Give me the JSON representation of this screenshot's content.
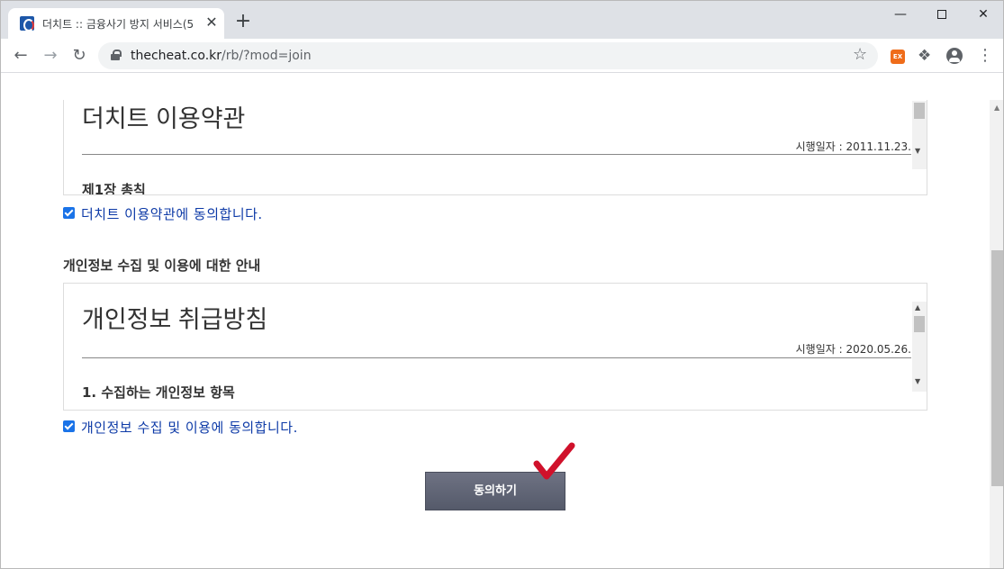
{
  "browser": {
    "tab_title": "더치트 :: 금융사기 방지 서비스(5",
    "tab_close": "✕",
    "new_tab": "+",
    "url_host": "thecheat.co.kr",
    "url_path": "/rb/?mod=join",
    "ext_badge": "EX",
    "icons": [
      "back-icon",
      "forward-icon",
      "reload-icon",
      "lock-icon",
      "star-icon",
      "extension-icon",
      "puzzle-icon",
      "profile-icon",
      "menu-icon"
    ]
  },
  "page": {
    "terms": {
      "title": "더치트 이용약관",
      "effective_date": "시행일자 : 2011.11.23.",
      "first_heading": "제1장 총칙",
      "agree_label": "더치트 이용약관에 동의합니다.",
      "checked": true
    },
    "privacy_section_heading": "개인정보 수집 및 이용에 대한 안내",
    "privacy": {
      "title": "개인정보 취급방침",
      "effective_date": "시행일자 : 2020.05.26.",
      "first_heading": "1. 수집하는 개인정보 항목",
      "agree_label": "개인정보 수집 및 이용에 동의합니다.",
      "checked": true
    },
    "submit_label": "동의하기",
    "annotation_color": "#d0112b"
  }
}
